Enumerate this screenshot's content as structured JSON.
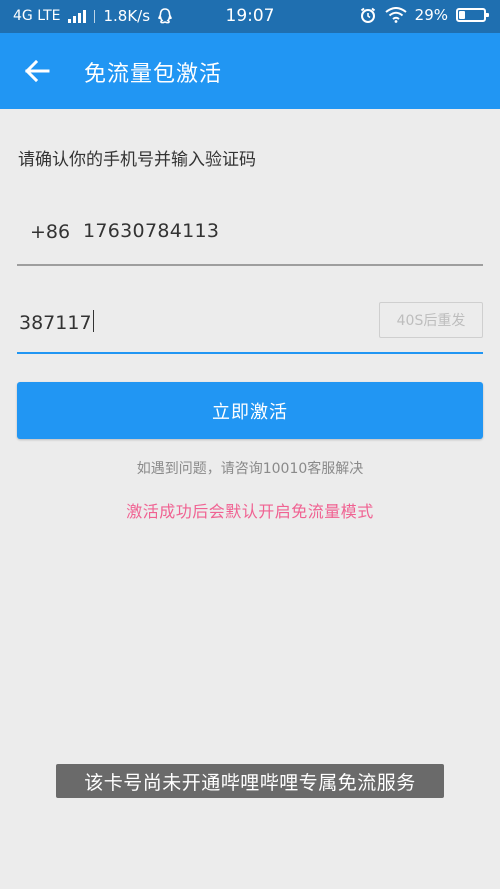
{
  "status_bar": {
    "network": "4G LTE",
    "speed": "1.8K/s",
    "time": "19:07",
    "battery": "29%",
    "battery_level": 0.29
  },
  "app_bar": {
    "title": "免流量包激活",
    "back_icon": "arrow-left-icon"
  },
  "form": {
    "instruction": "请确认你的手机号并输入验证码",
    "country_code": "+86",
    "phone_number": "17630784113",
    "verification_code": "387117",
    "resend_label": "40S后重发",
    "activate_label": "立即激活"
  },
  "help_text": "如遇到问题，请咨询10010客服解决",
  "notice_text": "激活成功后会默认开启免流量模式",
  "toast": "该卡号尚未开通哔哩哔哩专属免流服务",
  "colors": {
    "status_bar": "#1f6fb0",
    "primary": "#2196f3",
    "background": "#ececec",
    "notice": "#f06292",
    "toast": "#6a6a6a"
  }
}
